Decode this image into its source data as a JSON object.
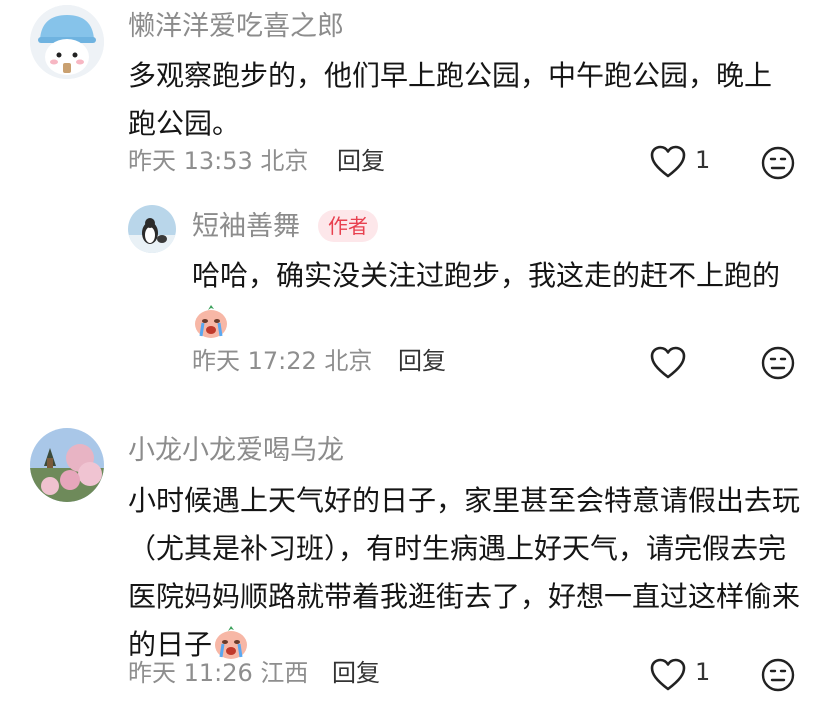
{
  "comments": [
    {
      "username": "懒洋洋爱吃喜之郎",
      "text": "多观察跑步的，他们早上跑公园，中午跑公园，晚上跑公园。",
      "meta": "昨天 13:53 北京",
      "reply_label": "回复",
      "like_count": "1"
    },
    {
      "username": "短袖善舞",
      "badge": "作者",
      "text": "哈哈，确实没关注过跑步，我这走的赶不上跑的",
      "meta": "昨天 17:22 北京",
      "reply_label": "回复",
      "like_count": ""
    },
    {
      "username": "小龙小龙爱喝乌龙",
      "text": "小时候遇上天气好的日子，家里甚至会特意请假出去玩（尤其是补习班），有时生病遇上好天气，请完假去完医院妈妈顺路就带着我逛街去了，好想一直过这样偷来的日子",
      "meta": "昨天 11:26 江西",
      "reply_label": "回复",
      "like_count": "1"
    }
  ],
  "icons": {
    "like": "heart-outline-icon",
    "dislike": "neutral-face-icon",
    "emoji": "crying-face-emoji"
  }
}
